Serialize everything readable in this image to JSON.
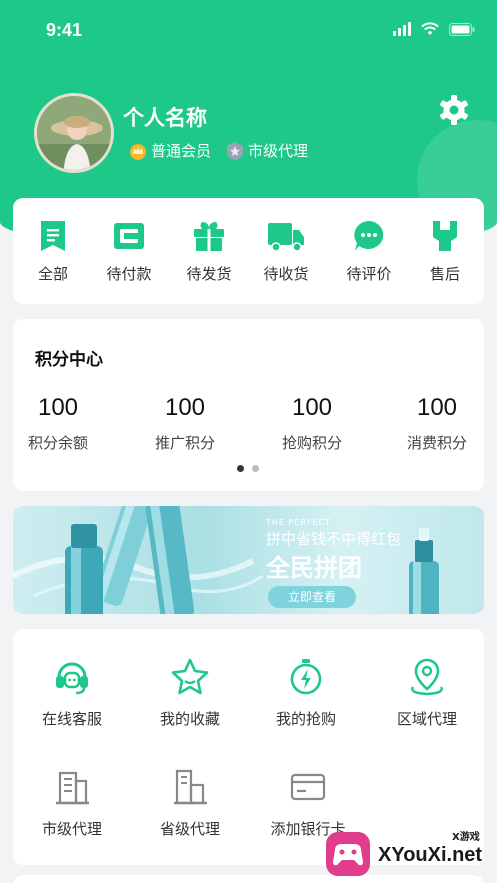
{
  "status_bar": {
    "time": "9:41"
  },
  "profile": {
    "name": "个人名称",
    "badges": [
      "普通会员",
      "市级代理"
    ]
  },
  "orders": {
    "items": [
      {
        "label": "全部",
        "icon": "bookmark-list-icon"
      },
      {
        "label": "待付款",
        "icon": "wallet-icon"
      },
      {
        "label": "待发货",
        "icon": "gift-icon"
      },
      {
        "label": "待收货",
        "icon": "truck-icon"
      },
      {
        "label": "待评价",
        "icon": "chat-bubble-icon"
      },
      {
        "label": "售后",
        "icon": "wrench-icon"
      }
    ]
  },
  "points": {
    "title": "积分中心",
    "items": [
      {
        "value": "100",
        "label": "积分余额"
      },
      {
        "value": "100",
        "label": "推广积分"
      },
      {
        "value": "100",
        "label": "抢购积分"
      },
      {
        "value": "100",
        "label": "消费积分"
      }
    ],
    "page_dots": 2,
    "active_dot": 0
  },
  "banner": {
    "subtitle": "THE PERFECT",
    "line1": "拼中省钱不中得红包",
    "line2": "全民拼团",
    "button": "立即查看"
  },
  "services": {
    "items": [
      {
        "label": "在线客服",
        "icon": "headset-icon"
      },
      {
        "label": "我的收藏",
        "icon": "star-icon"
      },
      {
        "label": "我的抢购",
        "icon": "stopwatch-icon"
      },
      {
        "label": "区域代理",
        "icon": "map-pin-icon"
      },
      {
        "label": "市级代理",
        "icon": "building-icon"
      },
      {
        "label": "省级代理",
        "icon": "office-building-icon"
      },
      {
        "label": "添加银行卡",
        "icon": "bank-card-icon"
      }
    ]
  },
  "watermark": {
    "text": "XYouXi.net",
    "small": "X游戏"
  },
  "colors": {
    "primary": "#1ec888",
    "icon_green": "#1ec888",
    "icon_gray": "#888888"
  }
}
